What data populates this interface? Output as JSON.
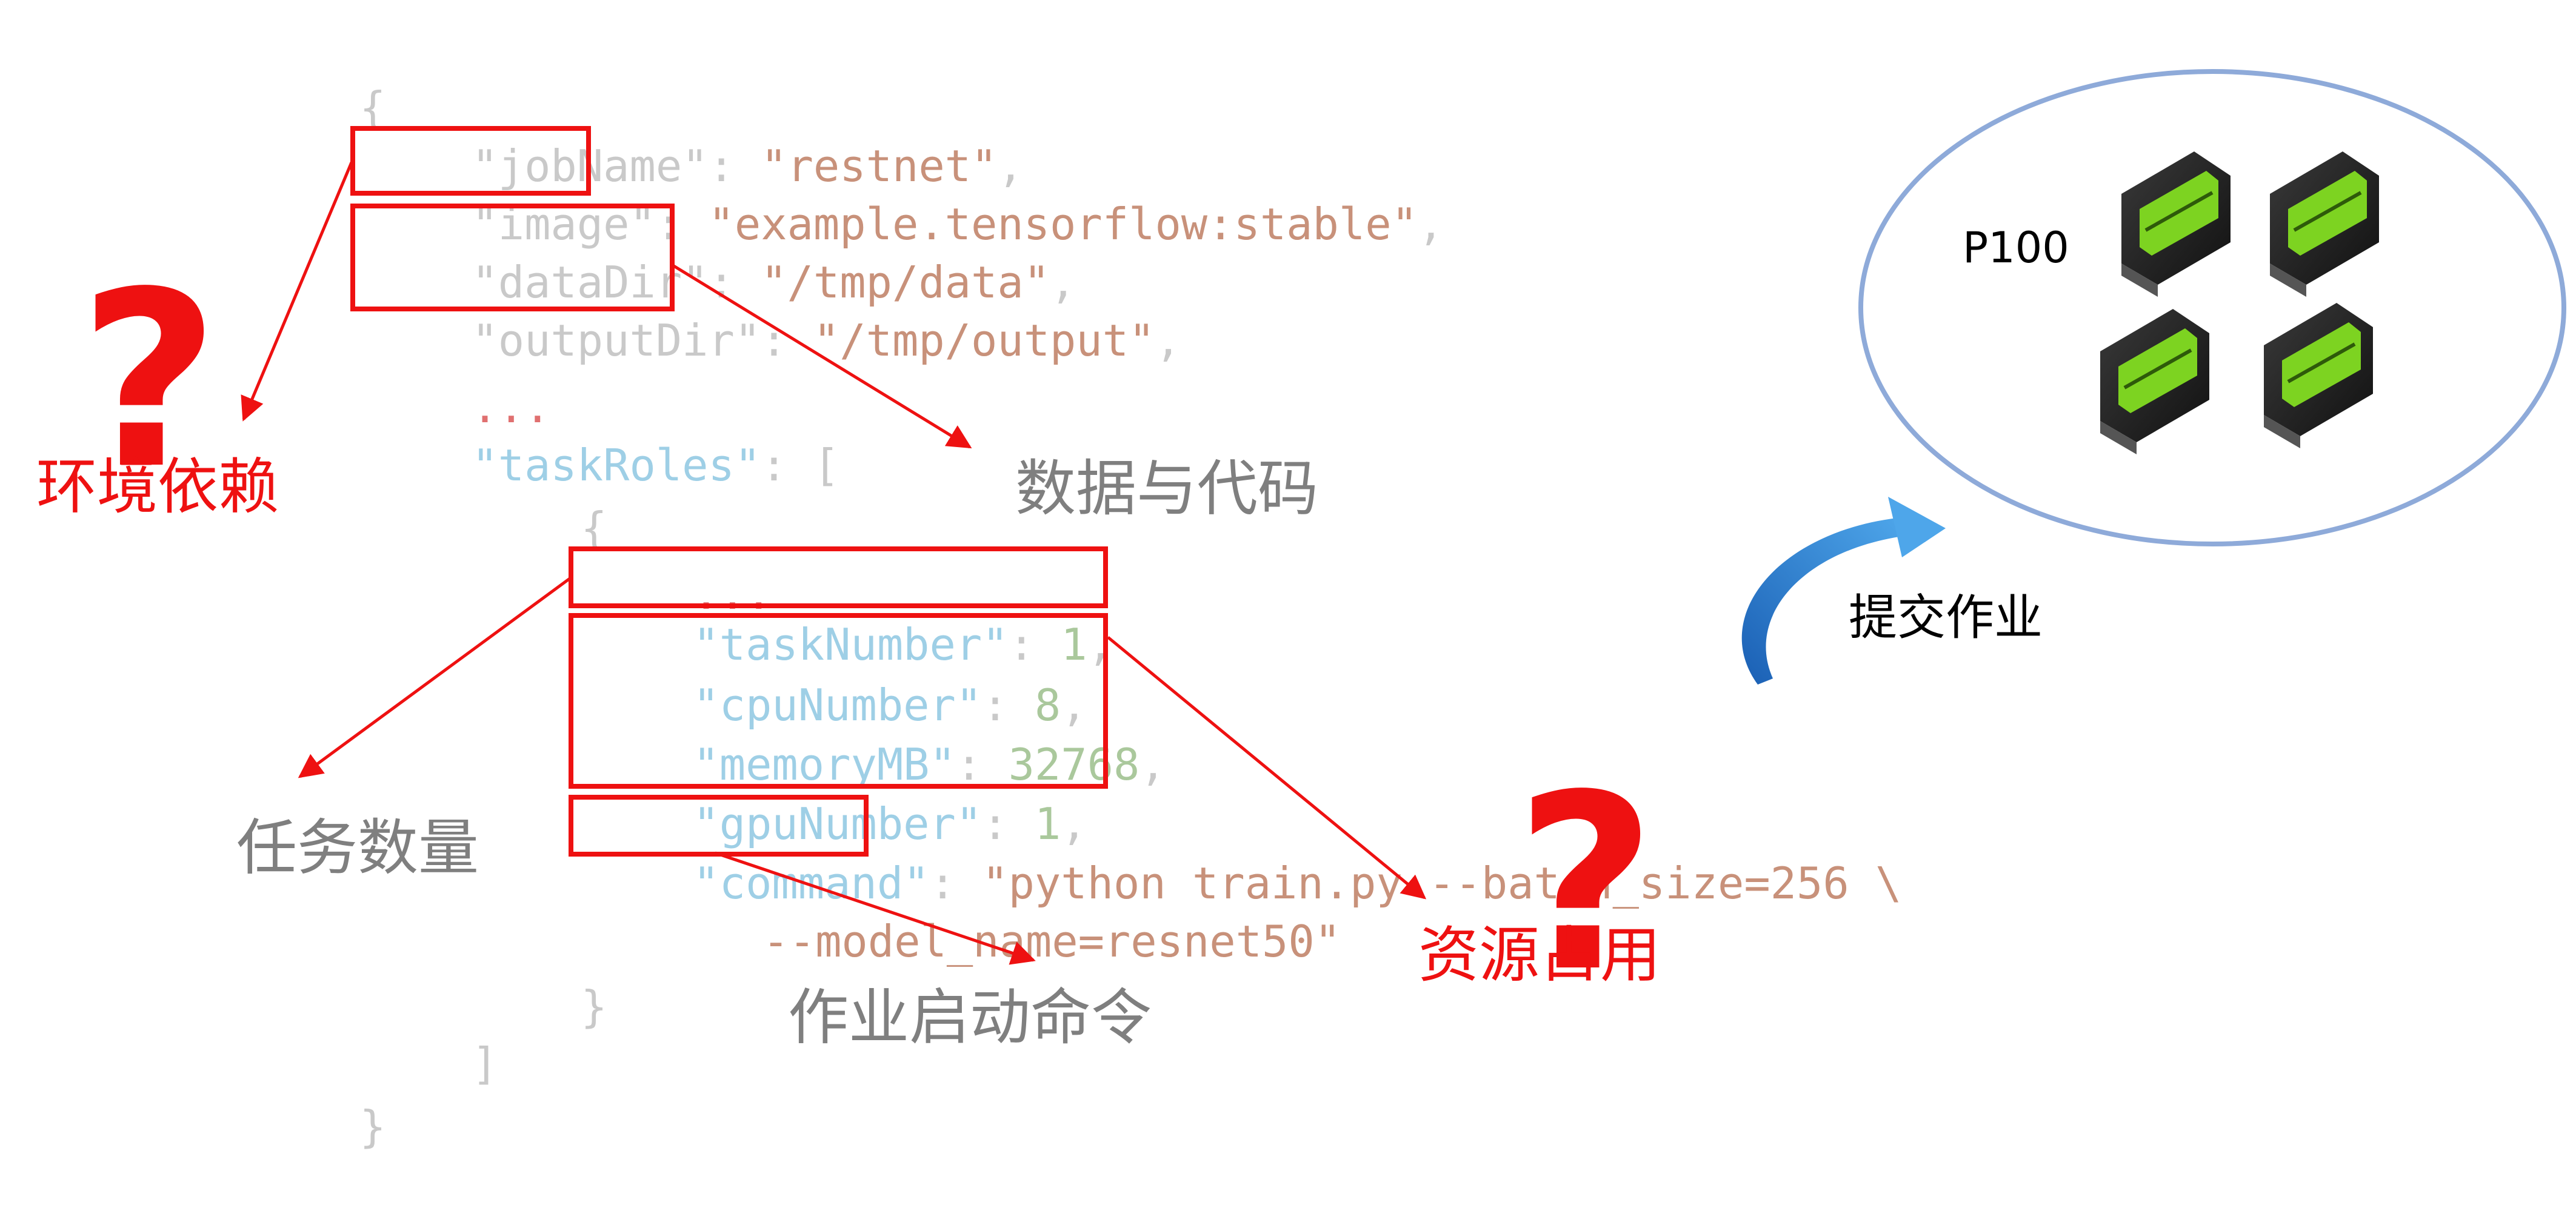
{
  "code": {
    "open_brace": "{",
    "job_name_key": "\"jobName\"",
    "job_name_sep": ": ",
    "job_name_value": "\"restnet\"",
    "job_name_comma": ",",
    "image_key": "\"image\"",
    "image_sep": ": ",
    "image_value": "\"example.tensorflow:stable\"",
    "image_comma": ",",
    "data_dir_key": "\"dataDir\"",
    "data_dir_sep": ": ",
    "data_dir_value": "\"/tmp/data\"",
    "data_dir_comma": ",",
    "output_dir_key": "\"outputDir\"",
    "output_dir_sep": ": ",
    "output_dir_value": "\"/tmp/output\"",
    "output_dir_comma": ",",
    "ellipsis_top": "...",
    "task_roles_key": "\"taskRoles\"",
    "task_roles_sep": ": [",
    "inner_open_brace": "{",
    "ellipsis_inner": "...",
    "task_number_key": "\"taskNumber\"",
    "task_number_sep": ": ",
    "task_number_value": "1",
    "task_number_comma": ",",
    "cpu_number_key": "\"cpuNumber\"",
    "cpu_number_sep": ": ",
    "cpu_number_value": "8",
    "cpu_number_comma": ",",
    "memory_key": "\"memoryMB\"",
    "memory_sep": ": ",
    "memory_value": "32768",
    "memory_comma": ",",
    "gpu_number_key": "\"gpuNumber\"",
    "gpu_number_sep": ": ",
    "gpu_number_value": "1",
    "gpu_number_comma": ",",
    "command_key": "\"command\"",
    "command_sep": ": ",
    "command_value_line1": "\"python train.py --batch_size=256 \\",
    "command_value_line2": "--model_name=resnet50\"",
    "inner_close_brace": "}",
    "close_bracket": "]",
    "close_brace": "}"
  },
  "annotations": {
    "env_dependency": "环境依赖",
    "data_and_code": "数据与代码",
    "task_count": "任务数量",
    "job_start_command": "作业启动命令",
    "resource_usage": "资源占用",
    "question_mark": "?"
  },
  "cluster": {
    "gpu_model": "P100",
    "submit_job": "提交作业",
    "gpu_count": 4
  },
  "colors": {
    "highlight": "#ee1111",
    "ellipse_stroke": "#8eaad9",
    "gpu_green": "#7dd321",
    "arrow_blue": "#2e7fd0"
  },
  "icons": [
    "gpu-card-icon",
    "curved-arrow-icon",
    "question-mark-icon"
  ]
}
